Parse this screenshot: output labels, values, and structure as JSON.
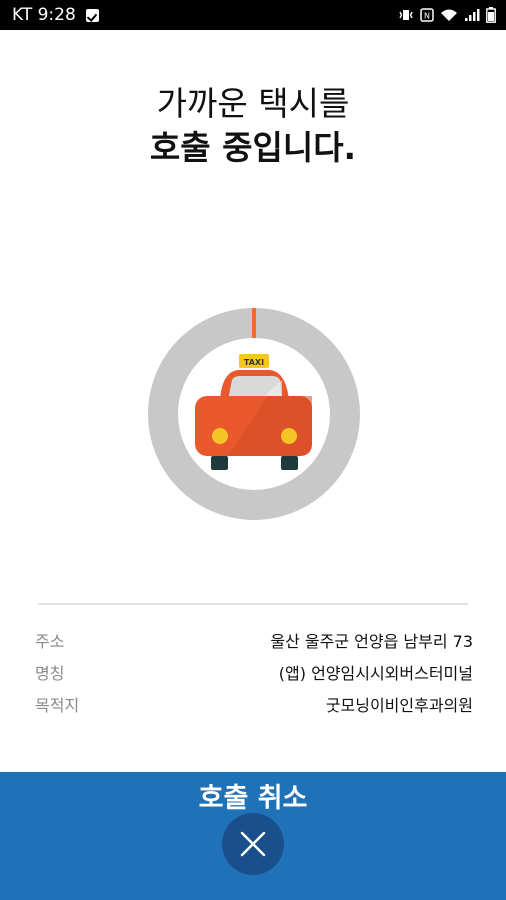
{
  "status_bar": {
    "carrier_time": "KT 9:28"
  },
  "title": {
    "line1": "가까운 택시를",
    "line2": "호출 중입니다."
  },
  "taxi": {
    "sign": "TAXI"
  },
  "info": {
    "rows": [
      {
        "label": "주소",
        "value": "울산 울주군 언양읍 남부리 73"
      },
      {
        "label": "명칭",
        "value": "(앱) 언양임시시외버스터미널"
      },
      {
        "label": "목적지",
        "value": "굿모닝이비인후과의원"
      }
    ]
  },
  "bottom": {
    "cancel_label": "호출 취소"
  },
  "colors": {
    "accent": "#1f72b8",
    "cancel_circle": "#1a4f8c",
    "taxi": "#e9592d",
    "ring": "#c8c8c8",
    "progress": "#f06a2f"
  }
}
